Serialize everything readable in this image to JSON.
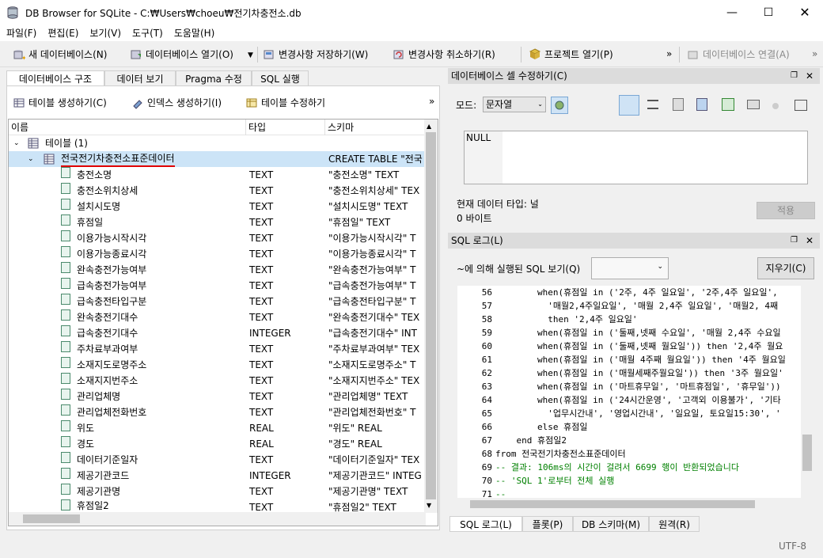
{
  "window": {
    "title": "DB Browser for SQLite - C:₩Users₩choeu₩전기차충전소.db"
  },
  "menu": [
    "파일(F)",
    "편집(E)",
    "보기(V)",
    "도구(T)",
    "도움말(H)"
  ],
  "toolbar": {
    "new_db": "새 데이터베이스(N)",
    "open_db": "데이터베이스 열기(O)",
    "write_changes": "변경사항 저장하기(W)",
    "revert_changes": "변경사항 취소하기(R)",
    "open_project": "프로젝트 열기(P)",
    "attach_db": "데이터베이스 연결(A)",
    "more": "»"
  },
  "tabs": [
    "데이터베이스 구조",
    "데이터 보기",
    "Pragma 수정",
    "SQL 실행"
  ],
  "structure_toolbar": {
    "create_table": "테이블 생성하기(C)",
    "create_index": "인덱스 생성하기(I)",
    "modify_table": "테이블 수정하기",
    "more": "»"
  },
  "tree": {
    "headers": {
      "name": "이름",
      "type": "타입",
      "schema": "스키마"
    },
    "tables_node": "테이블 (1)",
    "table": {
      "name": "전국전기차충전소표준데이터",
      "schema": "CREATE TABLE \"전국"
    },
    "fields": [
      {
        "name": "충전소명",
        "type": "TEXT",
        "schema": "\"충전소명\" TEXT"
      },
      {
        "name": "충전소위치상세",
        "type": "TEXT",
        "schema": "\"충전소위치상세\" TEX"
      },
      {
        "name": "설치시도명",
        "type": "TEXT",
        "schema": "\"설치시도명\" TEXT"
      },
      {
        "name": "휴점일",
        "type": "TEXT",
        "schema": "\"휴점일\" TEXT"
      },
      {
        "name": "이용가능시작시각",
        "type": "TEXT",
        "schema": "\"이용가능시작시각\" T"
      },
      {
        "name": "이용가능종료시각",
        "type": "TEXT",
        "schema": "\"이용가능종료시각\" T"
      },
      {
        "name": "완속충전가능여부",
        "type": "TEXT",
        "schema": "\"완속충전가능여부\" T"
      },
      {
        "name": "급속충전가능여부",
        "type": "TEXT",
        "schema": "\"급속충전가능여부\" T"
      },
      {
        "name": "급속충전타입구분",
        "type": "TEXT",
        "schema": "\"급속충전타입구분\" T"
      },
      {
        "name": "완속충전기대수",
        "type": "TEXT",
        "schema": "\"완속충전기대수\" TEX"
      },
      {
        "name": "급속충전기대수",
        "type": "INTEGER",
        "schema": "\"급속충전기대수\" INT"
      },
      {
        "name": "주차료부과여부",
        "type": "TEXT",
        "schema": "\"주차료부과여부\" TEX"
      },
      {
        "name": "소재지도로명주소",
        "type": "TEXT",
        "schema": "\"소재지도로명주소\" T"
      },
      {
        "name": "소재지지번주소",
        "type": "TEXT",
        "schema": "\"소재지지번주소\" TEX"
      },
      {
        "name": "관리업체명",
        "type": "TEXT",
        "schema": "\"관리업체명\" TEXT"
      },
      {
        "name": "관리업체전화번호",
        "type": "TEXT",
        "schema": "\"관리업체전화번호\" T"
      },
      {
        "name": "위도",
        "type": "REAL",
        "schema": "\"위도\" REAL"
      },
      {
        "name": "경도",
        "type": "REAL",
        "schema": "\"경도\" REAL"
      },
      {
        "name": "데이터기준일자",
        "type": "TEXT",
        "schema": "\"데이터기준일자\" TEX"
      },
      {
        "name": "제공기관코드",
        "type": "INTEGER",
        "schema": "\"제공기관코드\" INTEG"
      },
      {
        "name": "제공기관명",
        "type": "TEXT",
        "schema": "\"제공기관명\" TEXT"
      },
      {
        "name": "휴점일2",
        "type": "TEXT",
        "schema": "\"휴점일2\" TEXT"
      }
    ]
  },
  "edit_cell": {
    "title": "데이터베이스 셀 수정하기(C)",
    "mode_label": "모드:",
    "mode_value": "문자열",
    "value": "NULL",
    "type_info": "현재 데이터 타입: 널",
    "size_info": "0 바이트",
    "apply": "적용"
  },
  "sql_log": {
    "title": "SQL 로그(L)",
    "show_label": "~에 의해 실행된 SQL 보기(Q)",
    "clear": "지우기(C)",
    "lines": [
      {
        "n": "56",
        "t": "        when(휴점일 in ('2주, 4주 일요일', '2주,4주 일요일',"
      },
      {
        "n": "57",
        "t": "          '매월2,4주일요일', '매월 2,4주 일요일', '매월2, 4째"
      },
      {
        "n": "58",
        "t": "          then '2,4주 일요일'"
      },
      {
        "n": "59",
        "t": "        when(휴점일 in ('둘째,넷째 수요일', '매월 2,4주 수요일"
      },
      {
        "n": "60",
        "t": "        when(휴점일 in ('둘째,넷째 월요일')) then '2,4주 월요"
      },
      {
        "n": "61",
        "t": "        when(휴점일 in ('매월 4주째 월요일')) then '4주 월요일"
      },
      {
        "n": "62",
        "t": "        when(휴점일 in ('매월세째주월요일')) then '3주 월요일'"
      },
      {
        "n": "63",
        "t": "        when(휴점일 in ('마트휴무일', '마트휴점일', '휴무일'))"
      },
      {
        "n": "64",
        "t": "        when(휴점일 in ('24시간운영', '고객외 이용불가', '기타"
      },
      {
        "n": "65",
        "t": "          '업무시간내', '영업시간내', '일요일, 토요일15:30', '"
      },
      {
        "n": "66",
        "t": "        else 휴점일"
      },
      {
        "n": "67",
        "t": "    end 휴점일2"
      },
      {
        "n": "68",
        "t": "from 전국전기차충전소표준데이터"
      },
      {
        "n": "69",
        "t": "-- 결과: 106ms의 시간이 걸려서 6699 행이 반환되었습니다"
      },
      {
        "n": "70",
        "t": "-- 'SQL 1'로부터 전체 실행"
      },
      {
        "n": "71",
        "t": "--"
      }
    ]
  },
  "bottom_tabs": [
    "SQL 로그(L)",
    "플롯(P)",
    "DB 스키마(M)",
    "원격(R)"
  ],
  "status": {
    "encoding": "UTF-8"
  }
}
